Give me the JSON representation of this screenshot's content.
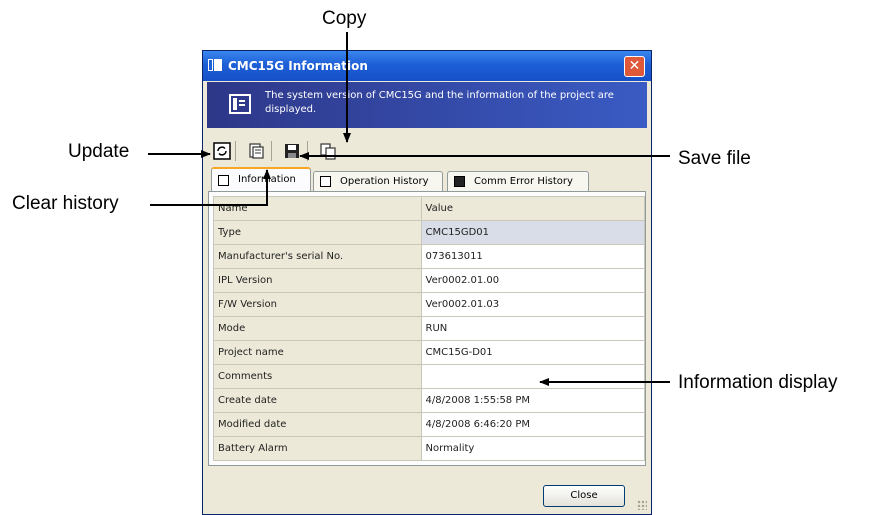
{
  "window": {
    "title": "CMC15G Information",
    "close_glyph": "✕"
  },
  "banner": {
    "text": "The system version of CMC15G and the information of the project are displayed."
  },
  "toolbar": {
    "icons": [
      "refresh-icon",
      "clear-history-icon",
      "save-icon",
      "copy-icon"
    ]
  },
  "tabs": [
    {
      "label": "Information",
      "active": true
    },
    {
      "label": "Operation History",
      "active": false
    },
    {
      "label": "Comm Error History",
      "active": false
    }
  ],
  "table": {
    "header": {
      "name": "Name",
      "value": "Value"
    },
    "rows": [
      {
        "name": "Type",
        "value": "CMC15GD01"
      },
      {
        "name": "Manufacturer's serial No.",
        "value": "073613011"
      },
      {
        "name": "IPL Version",
        "value": "Ver0002.01.00"
      },
      {
        "name": "F/W Version",
        "value": "Ver0002.01.03"
      },
      {
        "name": "Mode",
        "value": "RUN"
      },
      {
        "name": "Project name",
        "value": "CMC15G-D01"
      },
      {
        "name": "Comments",
        "value": ""
      },
      {
        "name": "Create date",
        "value": "4/8/2008 1:55:58 PM"
      },
      {
        "name": "Modified date",
        "value": "4/8/2008 6:46:20 PM"
      },
      {
        "name": "Battery Alarm",
        "value": "Normality"
      }
    ]
  },
  "footer": {
    "close_label": "Close"
  },
  "callouts": {
    "copy": "Copy",
    "update": "Update",
    "save_file": "Save file",
    "clear_history": "Clear history",
    "information_display": "Information display"
  },
  "colors": {
    "titlebar": "#1d5fd6",
    "banner": "#2e3788",
    "tab_accent": "#f5a623",
    "window_bg": "#ece9d8"
  }
}
